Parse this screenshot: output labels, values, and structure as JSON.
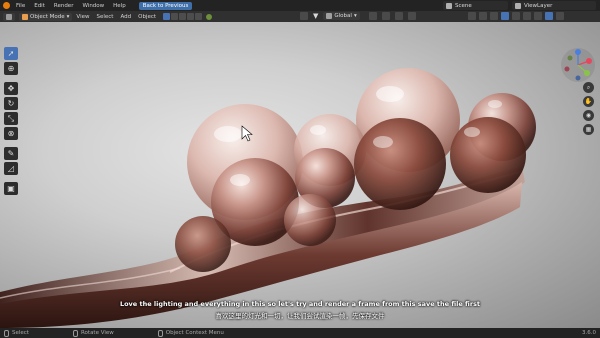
{
  "menubar": {
    "items": [
      "File",
      "Edit",
      "Render",
      "Window",
      "Help"
    ],
    "back_button": "Back to Previous",
    "scene": "Scene",
    "view_layer": "ViewLayer"
  },
  "header": {
    "mode": "Object Mode",
    "menus": [
      "View",
      "Select",
      "Add",
      "Object"
    ],
    "transform_orientation": "Global"
  },
  "toolbar": {
    "tools": [
      "select-box",
      "cursor",
      "move",
      "rotate",
      "scale",
      "transform",
      "annotate",
      "measure",
      "add-cube"
    ]
  },
  "gizmo": {
    "axes": [
      "X",
      "Y",
      "Z"
    ],
    "colors": {
      "x": "#e5485d",
      "y": "#8bc34a",
      "z": "#4a7fe0"
    }
  },
  "subtitles": {
    "english": "Love the lighting and everything in this so let's try and render a frame from this save the file first",
    "chinese": "喜欢这里的灯光和一切，让我们尝试渲染一帧，先保存文件"
  },
  "statusbar": {
    "items": [
      "Select",
      "Rotate View",
      "Object Context Menu"
    ],
    "version": "3.6.0"
  },
  "colors": {
    "accent": "#4772b3",
    "blender_orange": "#e87d0d"
  }
}
